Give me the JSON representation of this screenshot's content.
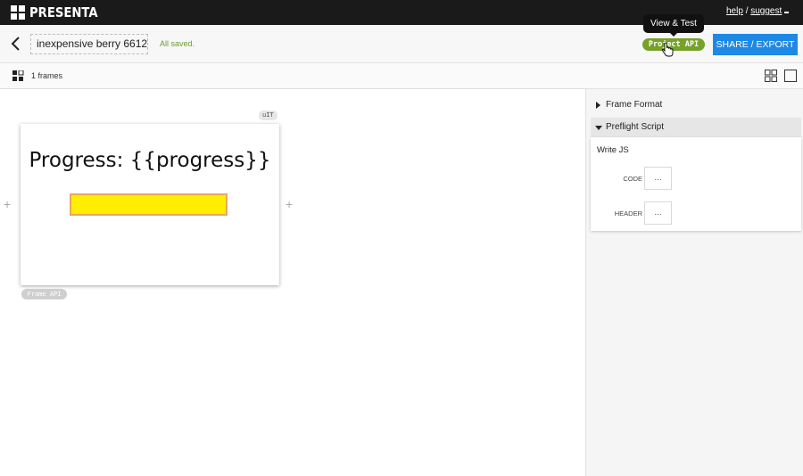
{
  "app": {
    "logo_text": "PRESENTA",
    "help_link": "help",
    "link_separator": "/",
    "suggest_link": "suggest"
  },
  "project": {
    "title": "inexpensive berry 6612",
    "save_status": "All saved.",
    "tooltip": "View & Test",
    "api_pill": "Project API",
    "share_button": "SHARE / EXPORT"
  },
  "frames_bar": {
    "count_label": "1 frames"
  },
  "canvas": {
    "badge_top": "uIT",
    "frame_text": "Progress: {{progress}}",
    "progress_fraction": 1.0,
    "progress_fill_color": "#ffee00",
    "progress_border_color": "#e8a85a",
    "plus_left": "+",
    "plus_right": "+",
    "badge_bottom": "Frame API"
  },
  "panel": {
    "frame_format_label": "Frame Format",
    "preflight_label": "Preflight Script",
    "write_js": "Write JS",
    "code_label": "CODE",
    "code_btn": "...",
    "header_label": "HEADER",
    "header_btn": "..."
  },
  "colors": {
    "accent_green": "#77a12a",
    "share_blue": "#1e88e5",
    "topbar_dark": "#1a1a1a"
  }
}
